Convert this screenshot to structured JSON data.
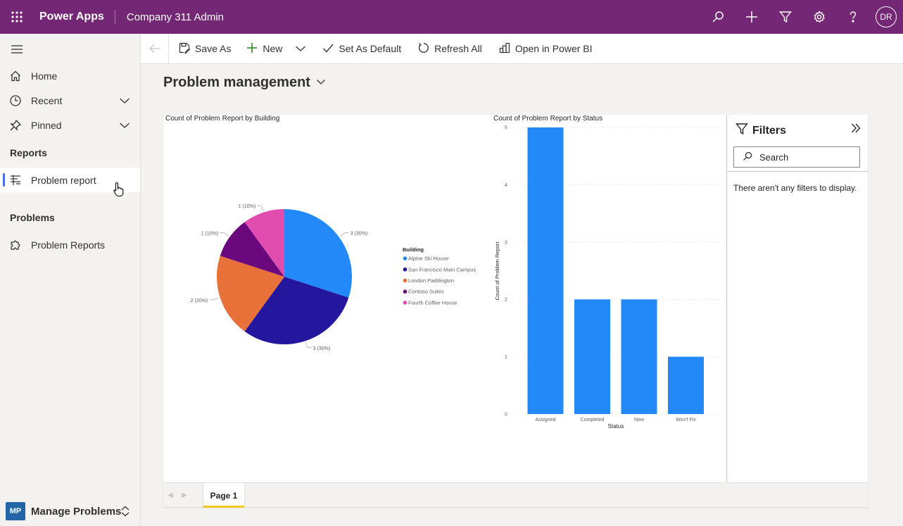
{
  "app": {
    "name": "Power Apps",
    "environment": "Company 311 Admin",
    "user_initials": "DR",
    "brand_color": "#742774"
  },
  "sidebar": {
    "nav": [
      {
        "label": "Home",
        "icon": "home-icon"
      },
      {
        "label": "Recent",
        "icon": "clock-icon"
      },
      {
        "label": "Pinned",
        "icon": "pin-icon"
      }
    ],
    "sections": [
      {
        "title": "Reports",
        "items": [
          {
            "label": "Problem report",
            "icon": "report-icon",
            "selected": true
          }
        ]
      },
      {
        "title": "Problems",
        "items": [
          {
            "label": "Problem Reports",
            "icon": "puzzle-icon",
            "selected": false
          }
        ]
      }
    ],
    "area": {
      "badge": "MP",
      "label": "Manage Problems"
    }
  },
  "commands": [
    {
      "label": "Save As",
      "icon": "save-as-icon"
    },
    {
      "label": "New",
      "icon": "plus-icon"
    },
    {
      "label": "Set As Default",
      "icon": "check-icon"
    },
    {
      "label": "Refresh All",
      "icon": "refresh-icon"
    },
    {
      "label": "Open in Power BI",
      "icon": "powerbi-icon"
    }
  ],
  "page_title": "Problem management",
  "filters": {
    "title": "Filters",
    "search_placeholder": "Search",
    "empty_message": "There aren't any filters to display."
  },
  "report_page": {
    "tab": "Page 1"
  },
  "chart_data": [
    {
      "type": "pie",
      "title": "Count of Problem Report by Building",
      "legend_title": "Building",
      "legend_position": "right",
      "categories": [
        "Alpine Ski House",
        "San Francisco Main Campus",
        "London Paddington",
        "Contoso Suites",
        "Fourth Coffee House"
      ],
      "values": [
        3,
        3,
        2,
        1,
        1
      ],
      "data_labels": [
        "3 (30%)",
        "3 (30%)",
        "2 (20%)",
        "1 (10%)",
        "1 (10%)"
      ],
      "colors": [
        "#2389f9",
        "#25169e",
        "#e8713a",
        "#6b087e",
        "#e14cb0"
      ]
    },
    {
      "type": "bar",
      "title": "Count of Problem Report by Status",
      "categories": [
        "Assigned",
        "Completed",
        "New",
        "Won't Fix"
      ],
      "values": [
        5,
        2,
        2,
        1
      ],
      "xlabel": "Status",
      "ylabel": "Count of Problem Report",
      "ylim": [
        0,
        5
      ],
      "yticks": [
        "0",
        "1",
        "2",
        "3",
        "4",
        "5"
      ],
      "grid": true,
      "color": "#2389f9"
    }
  ]
}
